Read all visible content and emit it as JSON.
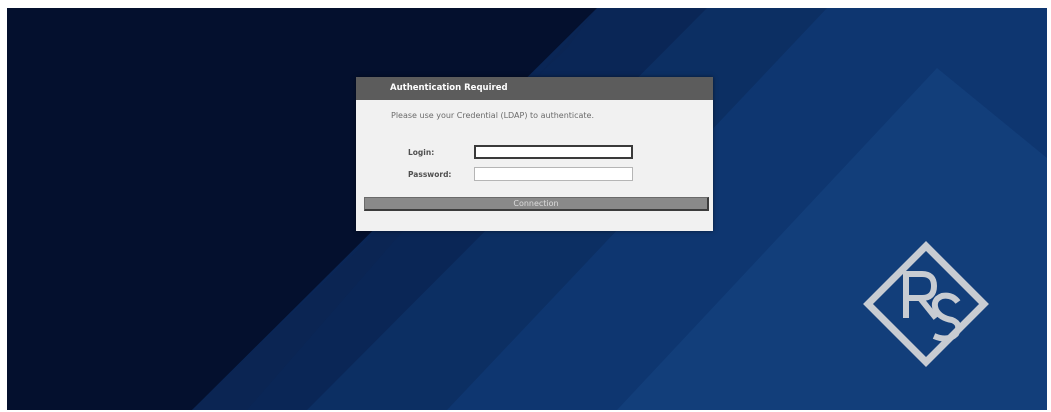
{
  "dialog": {
    "title": "Authentication Required",
    "message": "Please use your Credential (LDAP) to authenticate.",
    "login_label": "Login:",
    "login_value": "",
    "password_label": "Password:",
    "password_value": "",
    "connect_label": "Connection"
  },
  "logo": {
    "name": "rohde-schwarz-logo",
    "letters": "R&S"
  },
  "colors": {
    "background_dark": "#04102e",
    "background_blue": "#0e3a72",
    "header_bg": "#5c5c5c",
    "dialog_bg": "#f1f1f1",
    "button_bg": "#8a8a8a",
    "logo_color": "#c8ccd2"
  }
}
